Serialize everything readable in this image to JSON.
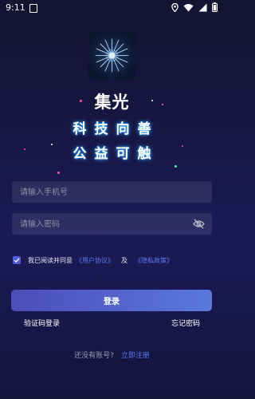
{
  "status_bar": {
    "time": "9:11"
  },
  "app": {
    "name": "集光"
  },
  "slogan": {
    "line1": "科技向善",
    "line2": "公益可触"
  },
  "form": {
    "phone_placeholder": "请输入手机号",
    "password_placeholder": "请输入密码"
  },
  "agreement": {
    "prefix": "我已阅读并同意",
    "user_agreement": "《用户协议》",
    "and": "及",
    "privacy_policy": "《隐私政策》",
    "checked": true
  },
  "login_button": "登录",
  "sms_login": "验证码登录",
  "forgot_password": "忘记密码",
  "register": {
    "prompt": "还没有账号?",
    "link": "立即注册"
  },
  "colors": {
    "accent": "#5b7cf0",
    "button_start": "#4d4eb8",
    "button_end": "#5a78dc",
    "background": "#171641"
  },
  "icons": {
    "eye": "eye-off-icon",
    "check": "checkmark-icon"
  }
}
